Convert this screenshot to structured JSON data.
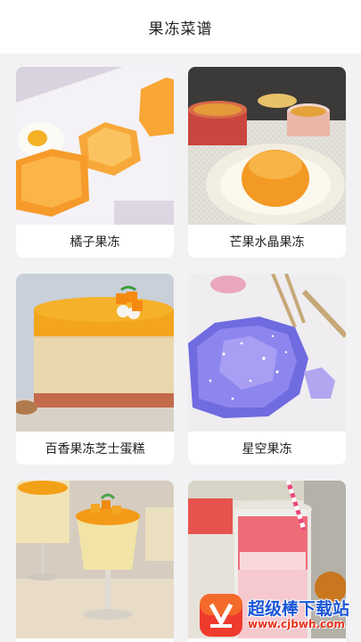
{
  "header": {
    "title": "果冻菜谱"
  },
  "recipes": [
    {
      "name": "橘子果冻"
    },
    {
      "name": "芒果水晶果冻"
    },
    {
      "name": "百香果冻芝士蛋糕"
    },
    {
      "name": "星空果冻"
    },
    {
      "name": ""
    },
    {
      "name": ""
    }
  ],
  "watermark": {
    "name": "超级棒下载站",
    "url": "www.cjbwh.com"
  },
  "colors": {
    "header_bg": "#ffffff",
    "page_bg": "#f2f2f4",
    "card_bg": "#ffffff",
    "text": "#222222"
  }
}
